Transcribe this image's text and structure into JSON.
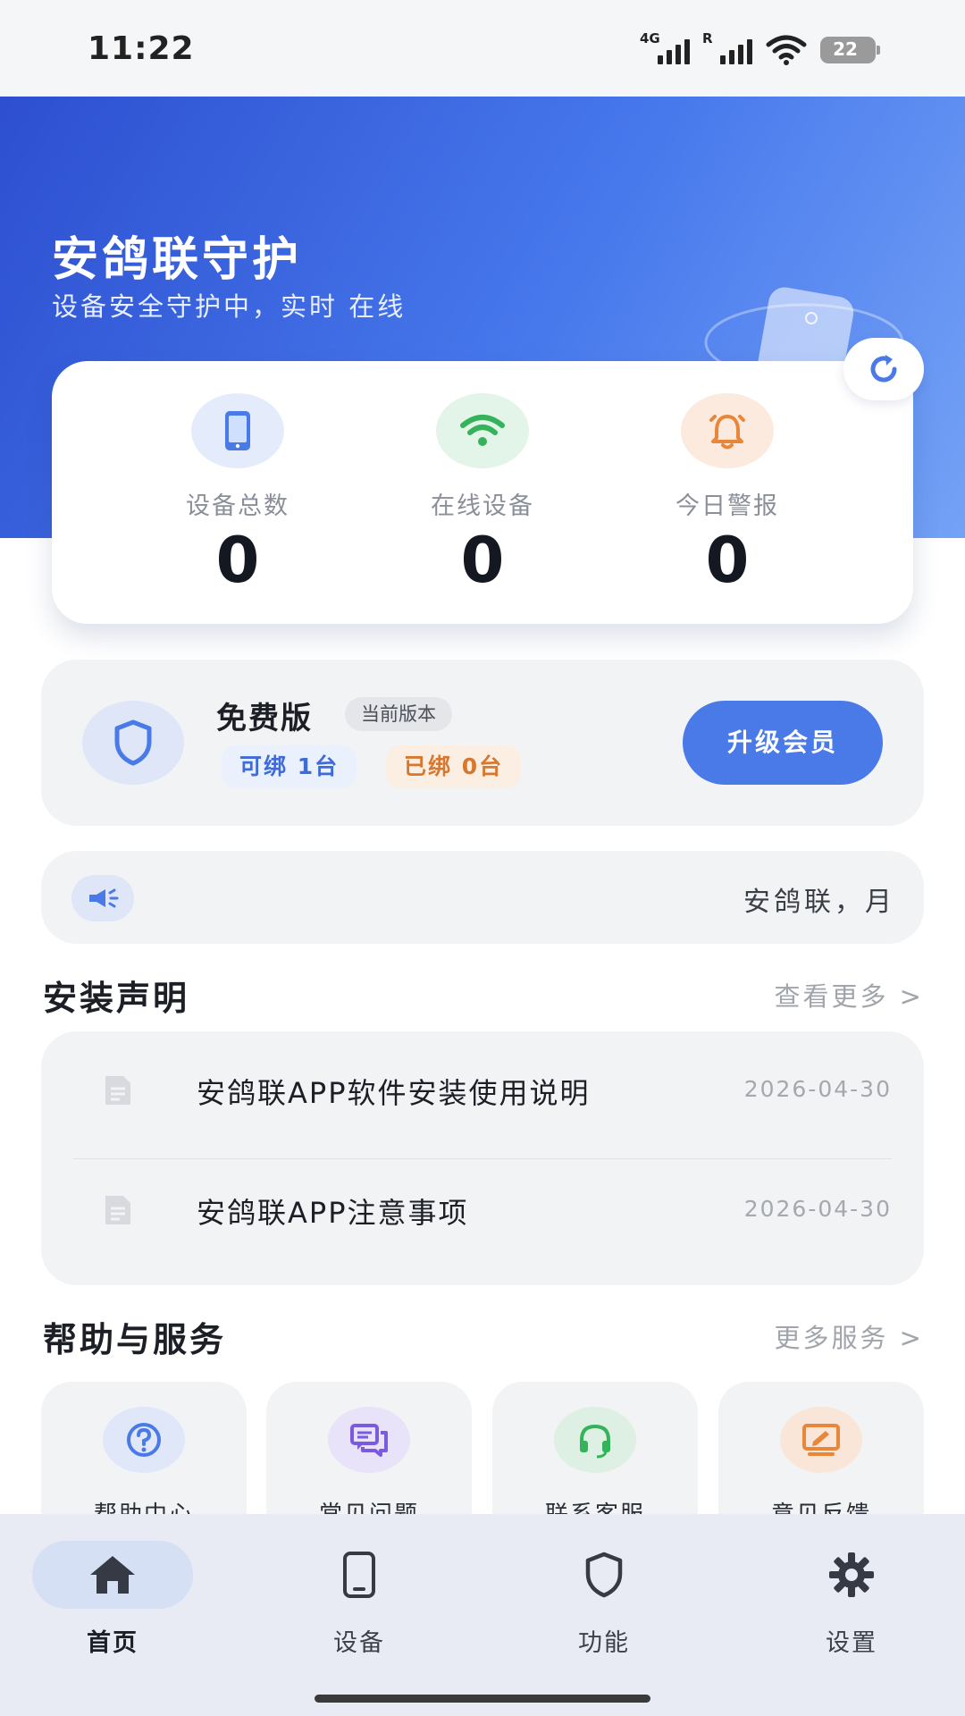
{
  "status_bar": {
    "time": "11:22",
    "signal_1_label": "4G",
    "signal_2_label": "R",
    "battery": "22"
  },
  "hero": {
    "title": "安鸽联守护",
    "subtitle": "设备安全守护中，实时 在线"
  },
  "stats": [
    {
      "label": "设备总数",
      "value": "0",
      "icon": "phone-icon",
      "color": "#4a7ae8",
      "bg": "#e4ecfb"
    },
    {
      "label": "在线设备",
      "value": "0",
      "icon": "wifi-icon",
      "color": "#34b35a",
      "bg": "#e3f4e8"
    },
    {
      "label": "今日警报",
      "value": "0",
      "icon": "alarm-bell-icon",
      "color": "#e8873a",
      "bg": "#fbeadd"
    }
  ],
  "plan": {
    "name": "免费版",
    "current_label": "当前版本",
    "bindable": "可绑 1台",
    "bound": "已绑 0台",
    "upgrade_label": "升级会员"
  },
  "notice": {
    "text": "安鸽联，月"
  },
  "install_section": {
    "title": "安装声明",
    "more": "查看更多 >",
    "items": [
      {
        "title": "安鸽联APP软件安装使用说明",
        "date": "2026-04-30"
      },
      {
        "title": "安鸽联APP注意事项",
        "date": "2026-04-30"
      }
    ]
  },
  "help_section": {
    "title": "帮助与服务",
    "more": "更多服务 >",
    "items": [
      {
        "label": "帮助中心",
        "icon": "help-circle-icon",
        "color": "#4a7ae8",
        "bg": "#dfe7f8"
      },
      {
        "label": "常见问题",
        "icon": "chat-bubbles-icon",
        "color": "#7a5be0",
        "bg": "#e8e3f8"
      },
      {
        "label": "联系客服",
        "icon": "headset-icon",
        "color": "#34b35a",
        "bg": "#ddf0e3"
      },
      {
        "label": "意见反馈",
        "icon": "feedback-edit-icon",
        "color": "#e8873a",
        "bg": "#f9e6d8"
      }
    ]
  },
  "tabbar": {
    "items": [
      {
        "label": "首页",
        "icon": "home-icon",
        "active": true
      },
      {
        "label": "设备",
        "icon": "phone-icon",
        "active": false
      },
      {
        "label": "功能",
        "icon": "shield-icon",
        "active": false
      },
      {
        "label": "设置",
        "icon": "gear-icon",
        "active": false
      }
    ]
  },
  "colors": {
    "accent": "#4a7ae8",
    "hero_start": "#2d4fd0",
    "hero_end": "#74a2f6"
  }
}
